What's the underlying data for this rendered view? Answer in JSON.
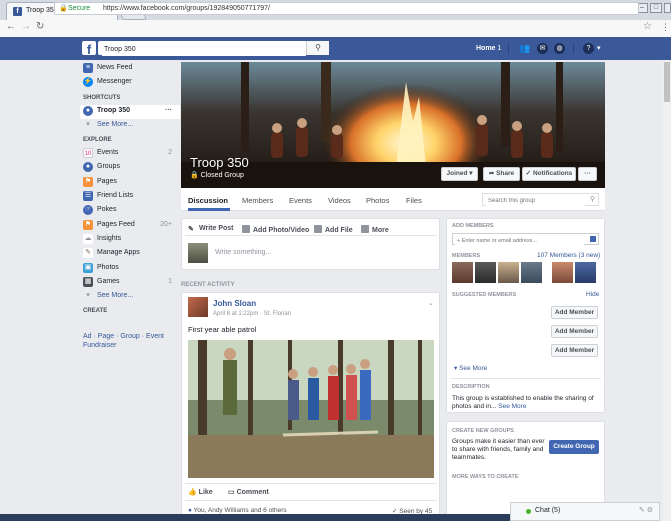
{
  "browser": {
    "tab_title": "Troop 350",
    "tab_close": "×",
    "secure_label": "Secure",
    "url": "https://www.facebook.com/groups/192849050771797/",
    "star": "☆",
    "menu": "⋮"
  },
  "fb_bar": {
    "search_value": "Troop 350",
    "home_label": "Home",
    "home_count": "1"
  },
  "left_nav": {
    "top_items": [
      {
        "label": "News Feed",
        "icon": "news-feed-icon",
        "color": "#4267b2"
      },
      {
        "label": "Messenger",
        "icon": "messenger-icon",
        "color": "#0084ff"
      }
    ],
    "shortcuts_heading": "SHORTCUTS",
    "shortcut_item": {
      "label": "Troop 350",
      "more": "···"
    },
    "see_more_1": "See More...",
    "explore_heading": "EXPLORE",
    "explore_items": [
      {
        "label": "Events",
        "count": "2",
        "icon": "calendar-icon",
        "glyph": "10",
        "color": "#e9ebee"
      },
      {
        "label": "Groups",
        "count": "",
        "icon": "groups-icon",
        "glyph": "●",
        "color": "#4267b2"
      },
      {
        "label": "Pages",
        "count": "",
        "icon": "pages-flag-icon",
        "glyph": "⚑",
        "color": "#f7923b"
      },
      {
        "label": "Friend Lists",
        "count": "",
        "icon": "friend-lists-icon",
        "glyph": "☰",
        "color": "#4267b2"
      },
      {
        "label": "Pokes",
        "count": "",
        "icon": "pokes-icon",
        "glyph": "☞",
        "color": "#4267b2"
      },
      {
        "label": "Pages Feed",
        "count": "20+",
        "icon": "pages-feed-icon",
        "glyph": "⚑",
        "color": "#f7923b"
      },
      {
        "label": "Insights",
        "count": "",
        "icon": "insights-icon",
        "glyph": "☁",
        "color": "#90949c"
      },
      {
        "label": "Manage Apps",
        "count": "",
        "icon": "manage-apps-icon",
        "glyph": "✎",
        "color": "#8b6a4a"
      },
      {
        "label": "Photos",
        "count": "",
        "icon": "photos-icon",
        "glyph": "▣",
        "color": "#3ea0d9"
      },
      {
        "label": "Games",
        "count": "1",
        "icon": "games-icon",
        "glyph": "▦",
        "color": "#4b4f56"
      }
    ],
    "see_more_2": "See More...",
    "create_heading": "CREATE",
    "create_line1": "Ad · Page · Group · Event",
    "create_line2": "Fundraiser"
  },
  "group": {
    "title": "Troop 350",
    "type": "Closed Group",
    "joined_btn": "Joined ▾",
    "share_btn": "Share",
    "notifications_btn": "Notifications",
    "more_btn": "···",
    "tabs": [
      "Discussion",
      "Members",
      "Events",
      "Videos",
      "Photos",
      "Files"
    ],
    "search_placeholder": "Search this group"
  },
  "composer": {
    "write_post": "Write Post",
    "add_photo": "Add Photo/Video",
    "add_file": "Add File",
    "more": "More",
    "placeholder": "Write something..."
  },
  "recent_activity_label": "RECENT ACTIVITY",
  "post": {
    "author": "John Sloan",
    "meta": "April 8 at 1:22pm · St. Florian",
    "text": "First year able patrol",
    "like": "Like",
    "comment": "Comment",
    "reactions": "You, Andy Williams and 6 others",
    "seen_by": "Seen by 45"
  },
  "right": {
    "add_members_heading": "ADD MEMBERS",
    "add_members_placeholder": "+ Enter name or email address...",
    "members_heading": "MEMBERS",
    "members_count": "107 Members (3 new)",
    "suggested_heading": "SUGGESTED MEMBERS",
    "hide": "Hide",
    "add_member_btn": "Add Member",
    "see_more": "See More",
    "description_heading": "DESCRIPTION",
    "description": "This group is established to enable the sharing of photos and in...",
    "description_more": "See More",
    "create_groups_heading": "CREATE NEW GROUPS",
    "create_groups_text": "Groups make it easier than ever to share with friends, family and teammates.",
    "create_group_btn": "Create Group",
    "more_ways_heading": "MORE WAYS TO CREATE"
  },
  "chat": {
    "label": "Chat (5)"
  }
}
